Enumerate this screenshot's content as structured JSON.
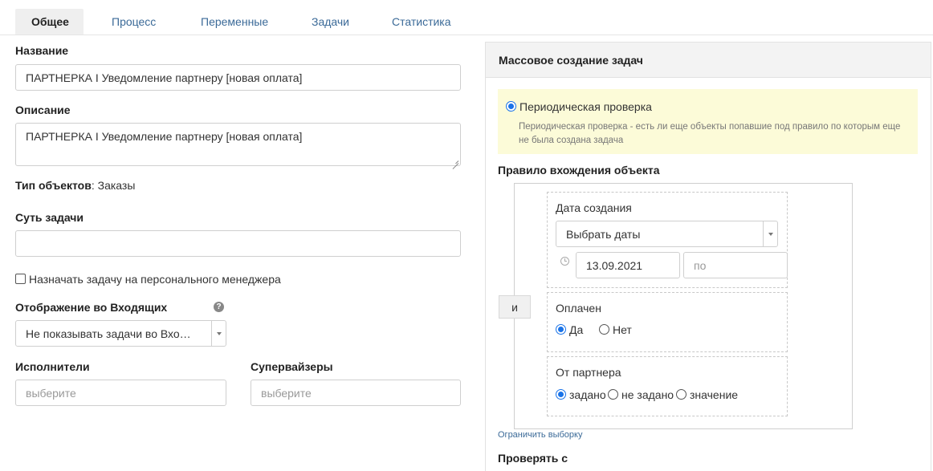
{
  "tabs": [
    "Общее",
    "Процесс",
    "Переменные",
    "Задачи",
    "Статистика"
  ],
  "form": {
    "name_label": "Название",
    "name_value": "ПАРТНЕРКА I Уведомление партнеру [новая оплата]",
    "description_label": "Описание",
    "description_value": "ПАРТНЕРКА I Уведомление партнеру [новая оплата]",
    "object_type_label": "Тип объектов",
    "object_type_value": ": Заказы",
    "essence_label": "Суть задачи",
    "essence_value": "",
    "assign_personal_label": "Назначать задачу на персонального менеджера",
    "inbox_label": "Отображение во Входящих",
    "inbox_value": "Не показывать задачи во Вхо…",
    "executors_label": "Исполнители",
    "executors_placeholder": "выберите",
    "supervisors_label": "Супервайзеры",
    "supervisors_placeholder": "выберите"
  },
  "panel": {
    "title": "Массовое создание задач",
    "periodic_label": "Периодическая проверка",
    "periodic_desc_1": "Периодическая проверка - есть ли еще объекты попавшие под правило по которым еще",
    "periodic_desc_2": "не была создана задача",
    "rule_label": "Правило вхождения объекта",
    "and_label": "и",
    "created_label": "Дата создания",
    "created_select": "Выбрать даты",
    "date_from": "13.09.2021",
    "date_to_placeholder": "по",
    "paid_label": "Оплачен",
    "paid_yes": "Да",
    "paid_no": "Нет",
    "partner_label": "От партнера",
    "partner_set": "задано",
    "partner_not_set": "не задано",
    "partner_value": "значение",
    "limit_link": "Ограничить выборку",
    "check_from_label": "Проверять с"
  },
  "colors": {
    "accent": "#1a73e8",
    "link": "#3b6a98",
    "notice_bg": "#fcfbd8"
  }
}
